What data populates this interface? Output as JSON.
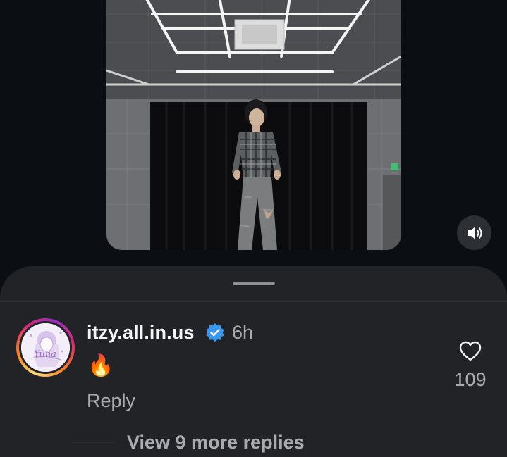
{
  "post": {
    "video_description": "dancer in plaid shirt and distressed jeans in practice studio",
    "mute_icon": "speaker-icon"
  },
  "comments_sheet": {
    "comment": {
      "username": "itzy.all.in.us",
      "verified": true,
      "timestamp": "6h",
      "text": "🔥",
      "reply_label": "Reply",
      "like_count": "109",
      "avatar_text": "Yuna",
      "view_replies_label": "View 9 more replies"
    }
  },
  "colors": {
    "background": "#0b0f14",
    "sheet": "#212327",
    "verified": "#3897f0",
    "secondary_text": "#a8abb0"
  }
}
